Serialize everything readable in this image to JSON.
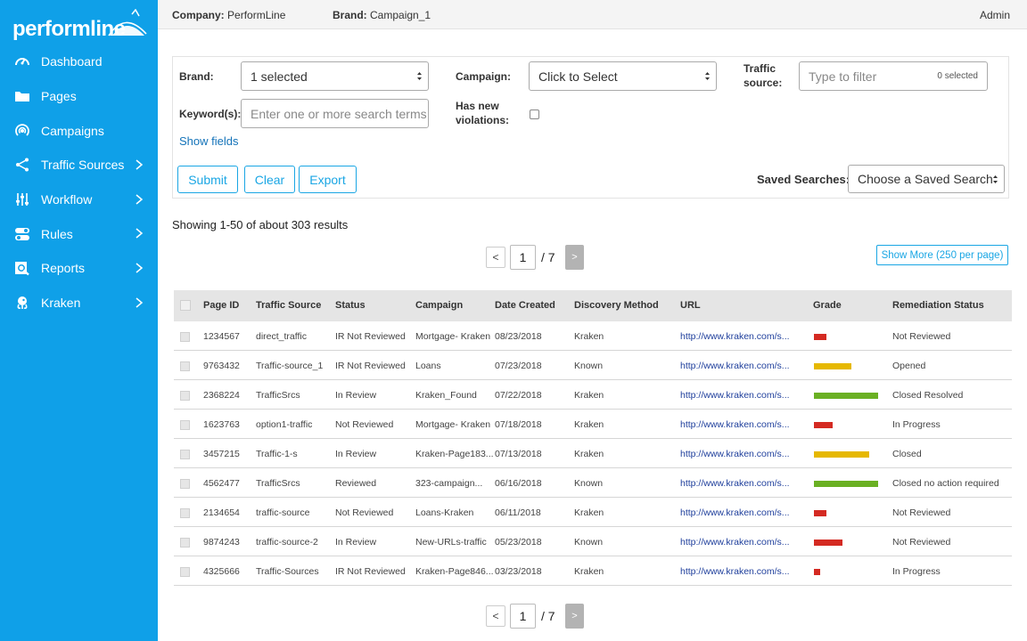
{
  "app": {
    "logo_text": "performline",
    "colors": {
      "sidebar": "#0fa0e8",
      "accent": "#1aa6e4",
      "link": "#1473b9",
      "grade_red": "#d42a22",
      "grade_yellow": "#e6b800",
      "grade_green": "#6ab023"
    }
  },
  "sidebar": {
    "items": [
      {
        "label": "Dashboard",
        "icon": "gauge-icon",
        "has_submenu": false
      },
      {
        "label": "Pages",
        "icon": "folder-icon",
        "has_submenu": false
      },
      {
        "label": "Campaigns",
        "icon": "broadcast-icon",
        "has_submenu": false
      },
      {
        "label": "Traffic Sources",
        "icon": "share-icon",
        "has_submenu": true
      },
      {
        "label": "Workflow",
        "icon": "sliders-icon",
        "has_submenu": true
      },
      {
        "label": "Rules",
        "icon": "toggles-icon",
        "has_submenu": true
      },
      {
        "label": "Reports",
        "icon": "report-search-icon",
        "has_submenu": true
      },
      {
        "label": "Kraken",
        "icon": "kraken-icon",
        "has_submenu": true
      }
    ]
  },
  "topbar": {
    "company_key": "Company:",
    "company_value": "PerformLine",
    "brand_key": "Brand:",
    "brand_value": "Campaign_1",
    "user": "Admin"
  },
  "filters": {
    "brand_label": "Brand:",
    "brand_value": "1 selected",
    "campaign_label": "Campaign:",
    "campaign_value": "Click to Select",
    "traffic_label_1": "Traffic",
    "traffic_label_2": "source:",
    "traffic_placeholder": "Type to filter",
    "traffic_count": "0 selected",
    "keyword_label": "Keyword(s):",
    "keyword_placeholder": "Enter one or more search terms",
    "violations_label_1": "Has new",
    "violations_label_2": "violations:",
    "show_fields": "Show fields",
    "submit": "Submit",
    "clear": "Clear",
    "export": "Export",
    "saved_label": "Saved Searches:",
    "saved_value": "Choose a Saved Search"
  },
  "results_text": "Showing 1-50 of about 303 results",
  "pagination": {
    "prev": "<",
    "page": "1",
    "total": "/ 7",
    "next": ">"
  },
  "show_more": "Show More (250 per page)",
  "table": {
    "columns": [
      "Page ID",
      "Traffic Source",
      "Status",
      "Campaign",
      "Date Created",
      "Discovery Method",
      "URL",
      "Grade",
      "Remediation Status"
    ],
    "rows": [
      {
        "page_id": "1234567",
        "traffic": "direct_traffic",
        "status": "IR Not Reviewed",
        "campaign": "Mortgage- Kraken",
        "date": "08/23/2018",
        "method": "Kraken",
        "url": "http://www.kraken.com/s...",
        "grade": 0.2,
        "grade_color": "red",
        "remediation": "Not Reviewed"
      },
      {
        "page_id": "9763432",
        "traffic": "Traffic-source_1",
        "status": "IR Not Reviewed",
        "campaign": "Loans",
        "date": "07/23/2018",
        "method": "Known",
        "url": "http://www.kraken.com/s...",
        "grade": 0.58,
        "grade_color": "yellow",
        "remediation": "Opened"
      },
      {
        "page_id": "2368224",
        "traffic": "TrafficSrcs",
        "status": "In Review",
        "campaign": "Kraken_Found",
        "date": "07/22/2018",
        "method": "Kraken",
        "url": "http://www.kraken.com/s...",
        "grade": 1.0,
        "grade_color": "green",
        "remediation": "Closed Resolved"
      },
      {
        "page_id": "1623763",
        "traffic": "option1-traffic",
        "status": "Not Reviewed",
        "campaign": "Mortgage- Kraken",
        "date": "07/18/2018",
        "method": "Kraken",
        "url": "http://www.kraken.com/s...",
        "grade": 0.29,
        "grade_color": "red",
        "remediation": "In Progress"
      },
      {
        "page_id": "3457215",
        "traffic": "Traffic-1-s",
        "status": "In Review",
        "campaign": "Kraken-Page183...",
        "date": "07/13/2018",
        "method": "Kraken",
        "url": "http://www.kraken.com/s...",
        "grade": 0.86,
        "grade_color": "yellow",
        "remediation": "Closed"
      },
      {
        "page_id": "4562477",
        "traffic": "TrafficSrcs",
        "status": "Reviewed",
        "campaign": "323-campaign...",
        "date": "06/16/2018",
        "method": "Known",
        "url": "http://www.kraken.com/s...",
        "grade": 1.0,
        "grade_color": "green",
        "remediation": "Closed no action required"
      },
      {
        "page_id": "2134654",
        "traffic": "traffic-source",
        "status": "Not Reviewed",
        "campaign": "Loans-Kraken",
        "date": "06/11/2018",
        "method": "Kraken",
        "url": "http://www.kraken.com/s...",
        "grade": 0.19,
        "grade_color": "red",
        "remediation": "Not Reviewed"
      },
      {
        "page_id": "9874243",
        "traffic": "traffic-source-2",
        "status": "In Review",
        "campaign": "New-URLs-traffic",
        "date": "05/23/2018",
        "method": "Known",
        "url": "http://www.kraken.com/s...",
        "grade": 0.44,
        "grade_color": "red",
        "remediation": "Not Reviewed"
      },
      {
        "page_id": "4325666",
        "traffic": "Traffic-Sources",
        "status": "IR Not Reviewed",
        "campaign": "Kraken-Page846...",
        "date": "03/23/2018",
        "method": "Kraken",
        "url": "http://www.kraken.com/s...",
        "grade": 0.1,
        "grade_color": "red",
        "remediation": "In Progress"
      }
    ]
  }
}
